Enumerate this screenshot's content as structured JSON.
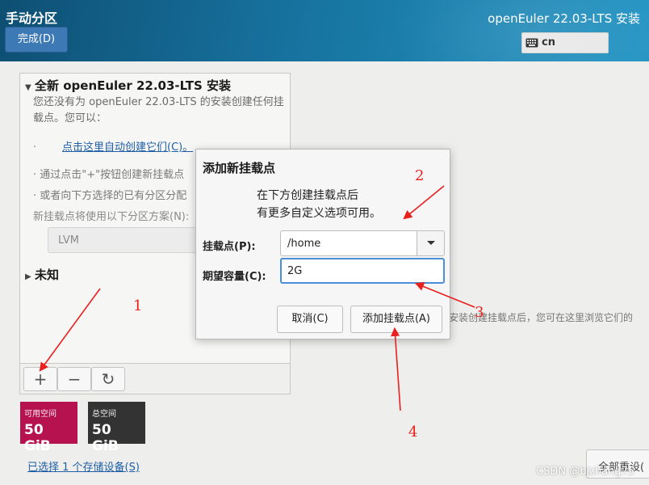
{
  "header": {
    "page_title": "手动分区",
    "done_button": "完成(D)",
    "product_title": "openEuler 22.03-LTS 安装",
    "keyboard_layout": "cn",
    "keyboard_icon": "keyboard-icon"
  },
  "left_panel": {
    "new_install_heading": "全新 openEuler 22.03-LTS 安装",
    "new_install_arrow": "▼",
    "description": "您还没有为 openEuler 22.03-LTS 的安装创建任何挂载点。您可以：",
    "bullet_auto_prefix": "·",
    "bullet_auto_link": "点击这里自动创建它们(C)。",
    "bullet_plus": "·  通过点击\"+\"按钮创建新挂载点",
    "bullet_assign": "·  或者向下方选择的已有分区分配",
    "scheme_label": "新挂载点将使用以下分区方案(N):",
    "scheme_value": "LVM",
    "unknown_heading": "未知",
    "unknown_arrow": "▶",
    "toolbar": {
      "add_label": "+",
      "remove_label": "−",
      "refresh_label": "↻"
    }
  },
  "space": {
    "available_label": "可用空间",
    "available_value": "50 GiB",
    "available_color": "#b5124f",
    "total_label": "总空间",
    "total_value": "50 GiB",
    "total_color": "#333333"
  },
  "storage_link": "已选择 1 个存储设备(S)",
  "right_hint": "安装创建挂载点后，您可在这里浏览它们的",
  "reset_button": "全部重设(",
  "dialog": {
    "title": "添加新挂载点",
    "description_line1": "在下方创建挂载点后",
    "description_line2": "有更多自定义选项可用。",
    "mount_point_label": "挂载点(P):",
    "mount_point_value": "/home",
    "capacity_label": "期望容量(C):",
    "capacity_value": "2G",
    "cancel_button": "取消(C)",
    "add_button": "添加挂载点(A)"
  },
  "annotations": {
    "color": "#e8201e",
    "labels": [
      "1",
      "2",
      "3",
      "4"
    ]
  },
  "watermark": "CSDN @bjzhang75"
}
